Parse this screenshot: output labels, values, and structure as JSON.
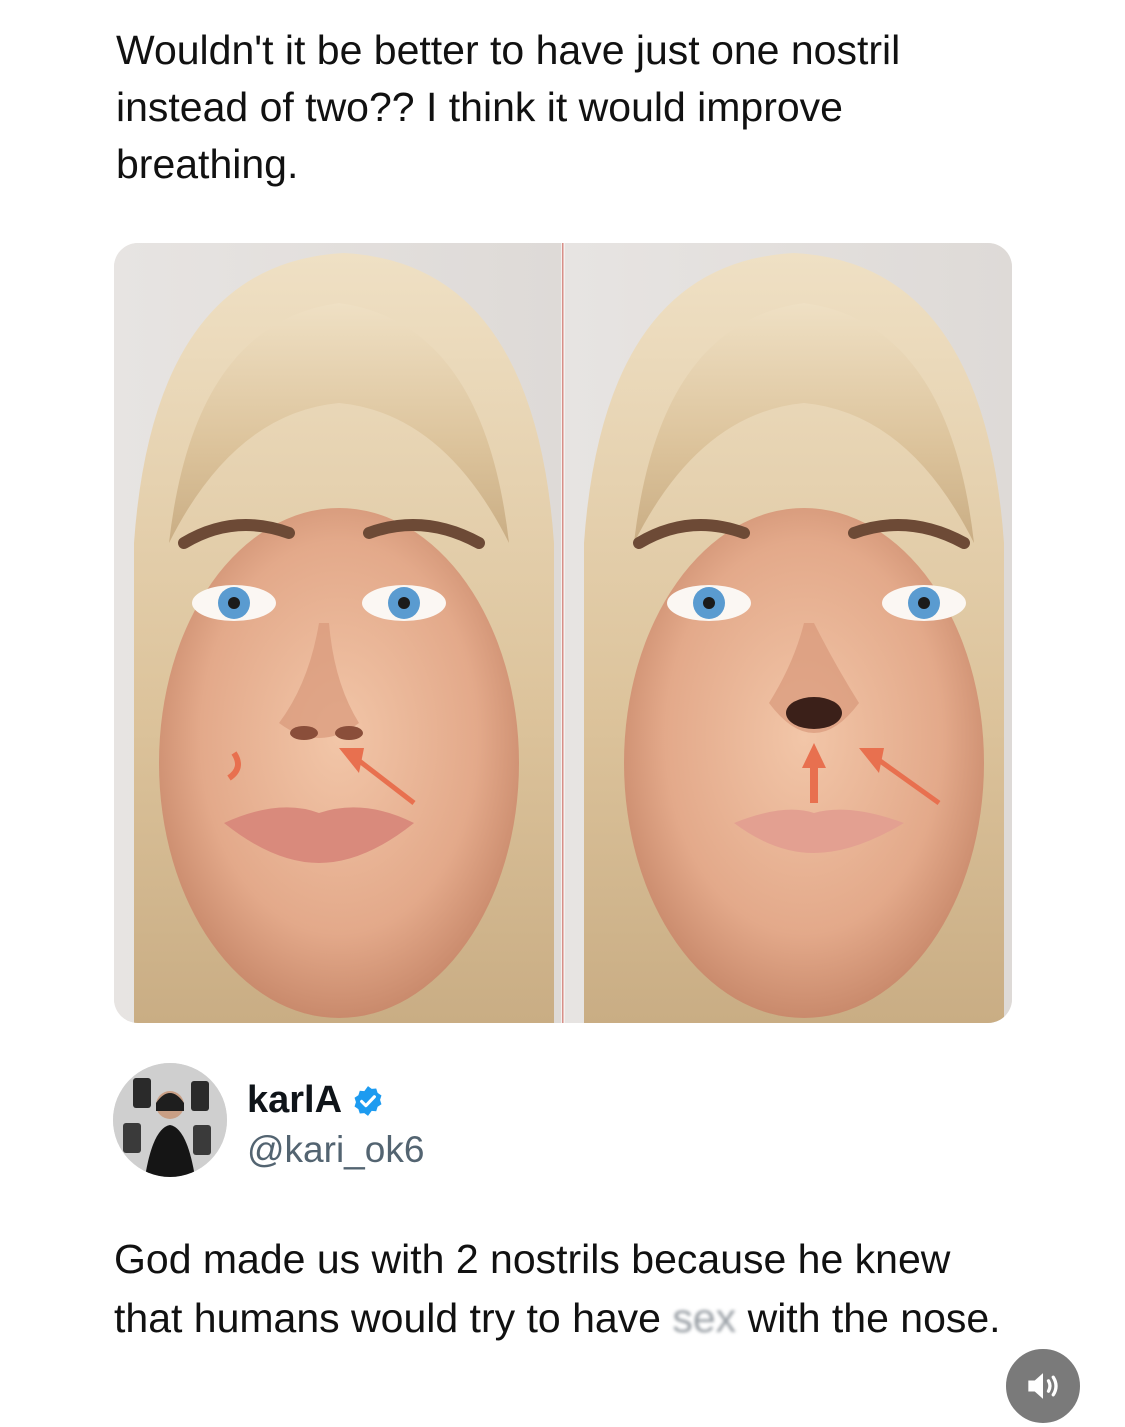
{
  "quoted_post": {
    "text": "Wouldn't it be better to have just one nostril\ninstead of two?? I think it would improve\nbreathing."
  },
  "media": {
    "alt": ""
  },
  "author": {
    "display_name": "karlA",
    "handle": "@kari_ok6",
    "verified": true,
    "avatar_icon": "avatar-photo",
    "badge_color": "#1d9bf0"
  },
  "reply": {
    "before": "God made us with 2 nostrils because he knew that humans would try to have ",
    "censored": "sex",
    "after": " with the nose."
  },
  "controls": {
    "sound_icon": "speaker-icon"
  }
}
